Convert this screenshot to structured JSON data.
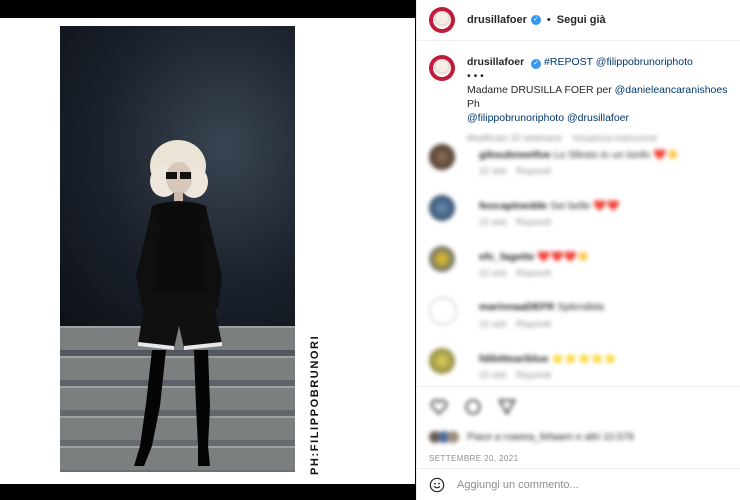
{
  "post": {
    "watermark": "PH:FILIPPOBRUNORI"
  },
  "header": {
    "username": "drusillafoer",
    "verified_mark": "✓",
    "separator": "•",
    "follow_label": "Segui già"
  },
  "caption": {
    "username": "drusillafoer",
    "tag": "#REPOST",
    "mention_photo": "@filippobrunoriphoto",
    "dots": "• • •",
    "text_prefix": "Madame DRUSILLA FOER per",
    "mention_shoes": "@danieleancaranishoes",
    "text_ph": "Ph",
    "mention_photo2": "@filippobrunoriphoto",
    "mention_user": "@drusillafoer",
    "meta_time": "Modificato 30 settimane",
    "meta_action": "Visualizza traduzione"
  },
  "comments": [
    {
      "user": "gibsubneetfoe",
      "text": "Lo Sfesto in un tonfo",
      "emoji": "❤️☀️",
      "time": "15 sett.",
      "reply": "Rispondi"
    },
    {
      "user": "feocaptnedde",
      "text": "Sei belle",
      "emoji": "❤️❤️",
      "time": "15 sett.",
      "reply": "Rispondi"
    },
    {
      "user": "efc_fagette",
      "text": "",
      "emoji": "❤️❤️❤️☀️",
      "time": "15 sett.",
      "reply": "Rispondi"
    },
    {
      "user": "marinnaaDEFR",
      "text": "Splendida",
      "emoji": "",
      "time": "15 sett.",
      "reply": "Rispondi"
    },
    {
      "user": "fdibitteariblue",
      "text": "",
      "emoji": "⭐⭐⭐⭐⭐",
      "time": "15 sett.",
      "reply": "Rispondi"
    }
  ],
  "likes": {
    "text": "Piace a roaeea_fefaaeri e altri 10.578"
  },
  "date": "SETTEMBRE 20, 2021",
  "add_comment": {
    "placeholder": "Aggiungi un commento..."
  },
  "colors": {
    "brand_red": "#c21a3b",
    "verified_blue": "#3897f0",
    "link": "#00376b"
  }
}
